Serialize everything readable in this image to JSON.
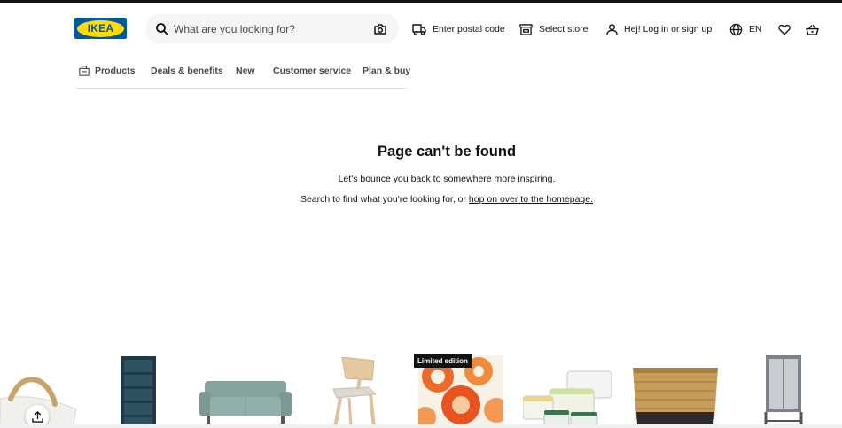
{
  "header": {
    "logo_text": "IKEA",
    "search": {
      "placeholder": "What are you looking for?"
    },
    "postal_label": "Enter postal code",
    "store_label": "Select store",
    "login_label": "Hej! Log in or sign up",
    "language_label": "EN"
  },
  "nav": {
    "items": [
      {
        "label": "Products"
      },
      {
        "label": "Deals & benefits"
      },
      {
        "label": "New"
      },
      {
        "label": "Customer service"
      },
      {
        "label": "Plan & buy"
      }
    ]
  },
  "main": {
    "title": "Page can't be found",
    "line1": "Let's bounce you back to somewhere more inspiring.",
    "line2_prefix": "Search to find what you're looking for, or ",
    "line2_link": "hop on over to the homepage."
  },
  "products": {
    "badge": "Limited edition"
  },
  "colors": {
    "brand_blue": "#0058A3",
    "brand_yellow": "#FFDB00"
  },
  "icons": [
    "search-icon",
    "camera-icon",
    "truck-icon",
    "store-icon",
    "user-icon",
    "globe-icon",
    "heart-icon",
    "basket-icon",
    "products-box-icon",
    "upload-icon"
  ]
}
